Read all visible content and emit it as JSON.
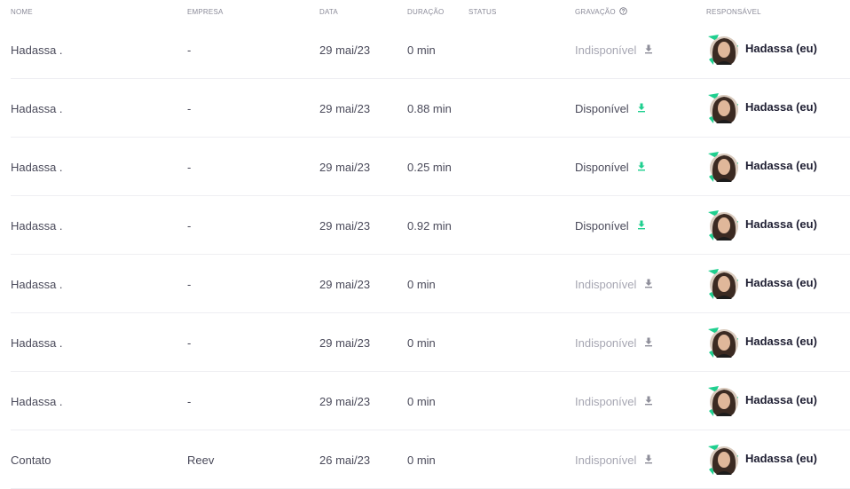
{
  "header": {
    "nome": "NOME",
    "empresa": "EMPRESA",
    "data": "DATA",
    "duracao": "DURAÇÃO",
    "status": "STATUS",
    "gravacao": "GRAVAÇÃO",
    "responsavel": "RESPONSÁVEL"
  },
  "colors": {
    "accent": "#1fcf8f",
    "unavailable": "#a6a6b2"
  },
  "rows": [
    {
      "nome": "Hadassa .",
      "empresa": "-",
      "data": "29 mai/23",
      "duracao": "0 min",
      "gravacao": "Indisponível",
      "disponivel": false,
      "responsavel": "Hadassa (eu)"
    },
    {
      "nome": "Hadassa .",
      "empresa": "-",
      "data": "29 mai/23",
      "duracao": "0.88 min",
      "gravacao": "Disponível",
      "disponivel": true,
      "responsavel": "Hadassa (eu)"
    },
    {
      "nome": "Hadassa .",
      "empresa": "-",
      "data": "29 mai/23",
      "duracao": "0.25 min",
      "gravacao": "Disponível",
      "disponivel": true,
      "responsavel": "Hadassa (eu)"
    },
    {
      "nome": "Hadassa .",
      "empresa": "-",
      "data": "29 mai/23",
      "duracao": "0.92 min",
      "gravacao": "Disponível",
      "disponivel": true,
      "responsavel": "Hadassa (eu)"
    },
    {
      "nome": "Hadassa .",
      "empresa": "-",
      "data": "29 mai/23",
      "duracao": "0 min",
      "gravacao": "Indisponível",
      "disponivel": false,
      "responsavel": "Hadassa (eu)"
    },
    {
      "nome": "Hadassa .",
      "empresa": "-",
      "data": "29 mai/23",
      "duracao": "0 min",
      "gravacao": "Indisponível",
      "disponivel": false,
      "responsavel": "Hadassa (eu)"
    },
    {
      "nome": "Hadassa .",
      "empresa": "-",
      "data": "29 mai/23",
      "duracao": "0 min",
      "gravacao": "Indisponível",
      "disponivel": false,
      "responsavel": "Hadassa (eu)"
    },
    {
      "nome": "Contato",
      "empresa": "Reev",
      "data": "26 mai/23",
      "duracao": "0 min",
      "gravacao": "Indisponível",
      "disponivel": false,
      "responsavel": "Hadassa (eu)"
    }
  ]
}
